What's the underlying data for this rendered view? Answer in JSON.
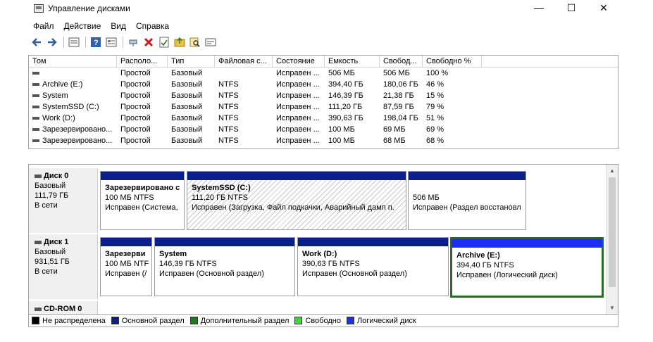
{
  "window": {
    "title": "Управление дисками",
    "minimize": "—",
    "maximize": "☐",
    "close": "✕"
  },
  "menu": [
    "Файл",
    "Действие",
    "Вид",
    "Справка"
  ],
  "toolbar": {
    "icons": [
      "back-arrow-icon",
      "forward-arrow-icon",
      "disk-list-icon",
      "help-icon",
      "properties-icon",
      "connect-icon",
      "delete-icon",
      "check-icon",
      "open-folder-icon",
      "search-icon",
      "console-icon"
    ]
  },
  "volumes": {
    "columns": [
      "Том",
      "Располо...",
      "Тип",
      "Файловая с...",
      "Состояние",
      "Емкость",
      "Свобод...",
      "Свободно %"
    ],
    "rows": [
      [
        "",
        "Простой",
        "Базовый",
        "",
        "Исправен ...",
        "506 МБ",
        "506 МБ",
        "100 %"
      ],
      [
        "Archive (E:)",
        "Простой",
        "Базовый",
        "NTFS",
        "Исправен ...",
        "394,40 ГБ",
        "180,06 ГБ",
        "46 %"
      ],
      [
        "System",
        "Простой",
        "Базовый",
        "NTFS",
        "Исправен ...",
        "146,39 ГБ",
        "21,38 ГБ",
        "15 %"
      ],
      [
        "SystemSSD (C:)",
        "Простой",
        "Базовый",
        "NTFS",
        "Исправен ...",
        "111,20 ГБ",
        "87,59 ГБ",
        "79 %"
      ],
      [
        "Work (D:)",
        "Простой",
        "Базовый",
        "NTFS",
        "Исправен ...",
        "390,63 ГБ",
        "198,04 ГБ",
        "51 %"
      ],
      [
        "Зарезервировано...",
        "Простой",
        "Базовый",
        "NTFS",
        "Исправен ...",
        "100 МБ",
        "69 МБ",
        "69 %"
      ],
      [
        "Зарезервировано...",
        "Простой",
        "Базовый",
        "NTFS",
        "Исправен ...",
        "100 МБ",
        "68 МБ",
        "68 %"
      ]
    ]
  },
  "disks": [
    {
      "name": "Диск 0",
      "type": "Базовый",
      "size": "111,79 ГБ",
      "status": "В сети",
      "partitions": [
        {
          "name": "Зарезервировано с",
          "size": "100 МБ NTFS",
          "status": "Исправен (Система,",
          "style": "primary"
        },
        {
          "name": "SystemSSD  (C:)",
          "size": "111,20 ГБ NTFS",
          "status": "Исправен (Загрузка, Файл подкачки, Аварийный дамп п.",
          "style": "primary-hatched"
        },
        {
          "name": "",
          "size": "506 МБ",
          "status": "Исправен (Раздел восстановл",
          "style": "primary"
        }
      ]
    },
    {
      "name": "Диск 1",
      "type": "Базовый",
      "size": "931,51 ГБ",
      "status": "В сети",
      "partitions": [
        {
          "name": "Зарезерви",
          "size": "100 МБ NTF",
          "status": "Исправен (/",
          "style": "primary"
        },
        {
          "name": "System",
          "size": "146,39 ГБ NTFS",
          "status": "Исправен (Основной раздел)",
          "style": "primary"
        },
        {
          "name": "Work  (D:)",
          "size": "390,63 ГБ NTFS",
          "status": "Исправен (Основной раздел)",
          "style": "primary"
        },
        {
          "name": "Archive  (E:)",
          "size": "394,40 ГБ NTFS",
          "status": "Исправен (Логический диск)",
          "style": "logical-selected"
        }
      ]
    },
    {
      "name": "CD-ROM 0"
    }
  ],
  "legend": [
    {
      "label": "Не распределена",
      "color": "#000000"
    },
    {
      "label": "Основной раздел",
      "color": "#0a1e8c"
    },
    {
      "label": "Дополнительный раздел",
      "color": "#1e7a1e"
    },
    {
      "label": "Свободно",
      "color": "#33dd33"
    },
    {
      "label": "Логический диск",
      "color": "#1a2ff0"
    }
  ]
}
